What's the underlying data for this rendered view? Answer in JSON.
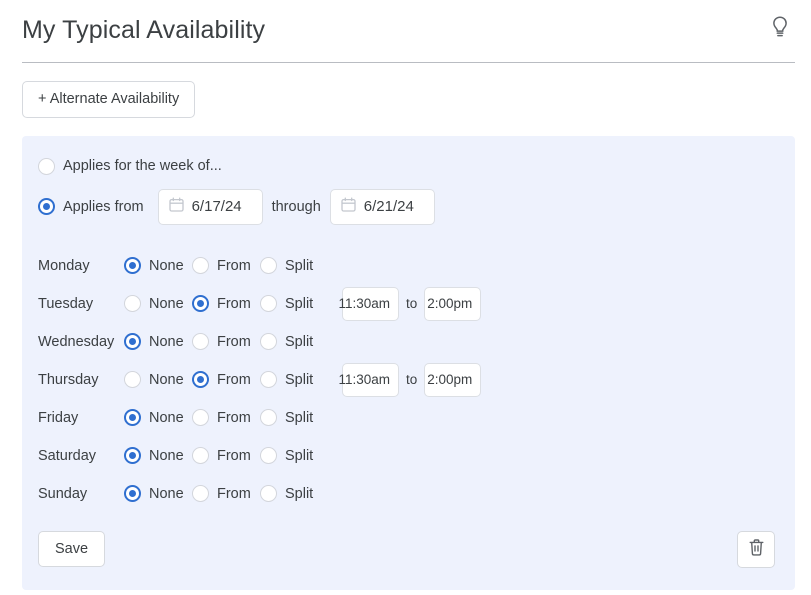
{
  "header": {
    "title": "My Typical Availability",
    "hint_icon": "lightbulb-icon"
  },
  "toolbar": {
    "alternate_availability_label": "+ Alternate Availability"
  },
  "panel": {
    "scope_options": [
      {
        "label": "Applies for the week of...",
        "selected": false
      },
      {
        "label": "Applies from",
        "selected": true
      }
    ],
    "date_from": "6/17/24",
    "through_label": "through",
    "date_through": "6/21/24",
    "calendar_icon": "calendar-icon",
    "mode_labels": [
      "None",
      "From",
      "Split"
    ],
    "to_label": "to",
    "days": [
      {
        "name": "Monday",
        "mode": "None",
        "has_times": false,
        "time_start": "",
        "time_end": ""
      },
      {
        "name": "Tuesday",
        "mode": "From",
        "has_times": true,
        "time_start": "11:30am",
        "time_end": "2:00pm"
      },
      {
        "name": "Wednesday",
        "mode": "None",
        "has_times": false,
        "time_start": "",
        "time_end": ""
      },
      {
        "name": "Thursday",
        "mode": "From",
        "has_times": true,
        "time_start": "11:30am",
        "time_end": "2:00pm"
      },
      {
        "name": "Friday",
        "mode": "None",
        "has_times": false,
        "time_start": "",
        "time_end": ""
      },
      {
        "name": "Saturday",
        "mode": "None",
        "has_times": false,
        "time_start": "",
        "time_end": ""
      },
      {
        "name": "Sunday",
        "mode": "None",
        "has_times": false,
        "time_start": "",
        "time_end": ""
      }
    ],
    "save_label": "Save",
    "delete_icon": "trash-icon"
  },
  "colors": {
    "accent_blue": "#2f6fd0",
    "panel_bg": "#eef2fd",
    "text": "#3c4043",
    "border": "#d6d9de"
  }
}
